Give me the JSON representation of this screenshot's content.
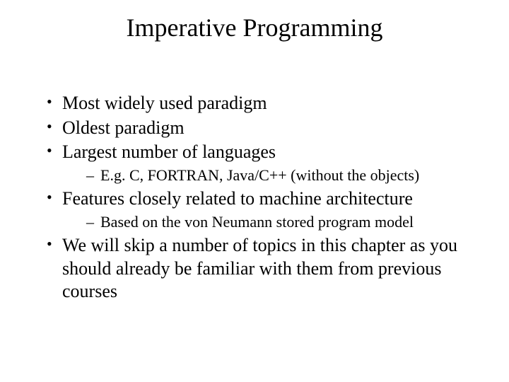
{
  "title": "Imperative Programming",
  "bullets": {
    "b1": "Most widely used paradigm",
    "b2": "Oldest paradigm",
    "b3": "Largest number of languages",
    "b3_sub1": "E.g. C, FORTRAN, Java/C++ (without the objects)",
    "b4": "Features closely related to machine architecture",
    "b4_sub1": "Based on the von Neumann stored program model",
    "b5": "We will skip a number of topics in this chapter as you should already be familiar with them from previous courses"
  }
}
